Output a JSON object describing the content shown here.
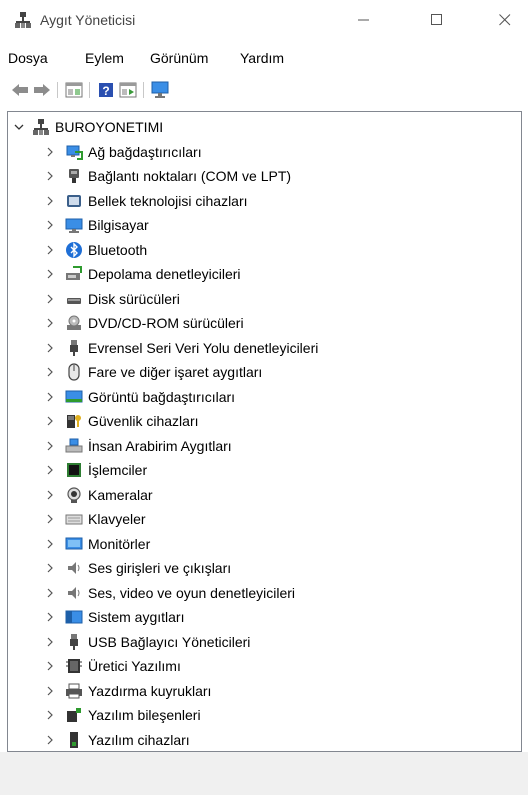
{
  "window": {
    "title": "Aygıt Yöneticisi"
  },
  "menu": [
    "Dosya",
    "Eylem",
    "Görünüm",
    "Yardım"
  ],
  "toolbar": {
    "buttons": [
      {
        "name": "back-icon"
      },
      {
        "name": "forward-icon"
      },
      {
        "name": "properties-icon"
      },
      {
        "name": "help-icon"
      },
      {
        "name": "update-driver-icon"
      },
      {
        "name": "scan-hardware-icon"
      }
    ]
  },
  "tree": {
    "root": {
      "label": "BUROYONETIMI",
      "expanded": true,
      "icon": "computer-icon"
    },
    "items": [
      {
        "label": "Ağ bağdaştırıcıları",
        "icon": "network-adapter-icon"
      },
      {
        "label": "Bağlantı noktaları (COM ve LPT)",
        "icon": "port-icon"
      },
      {
        "label": "Bellek teknolojisi cihazları",
        "icon": "memory-device-icon"
      },
      {
        "label": "Bilgisayar",
        "icon": "computer-monitor-icon"
      },
      {
        "label": "Bluetooth",
        "icon": "bluetooth-icon"
      },
      {
        "label": "Depolama denetleyicileri",
        "icon": "storage-controller-icon"
      },
      {
        "label": "Disk sürücüleri",
        "icon": "disk-drive-icon"
      },
      {
        "label": "DVD/CD-ROM sürücüleri",
        "icon": "dvd-drive-icon"
      },
      {
        "label": "Evrensel Seri Veri Yolu denetleyicileri",
        "icon": "usb-controller-icon"
      },
      {
        "label": "Fare ve diğer işaret aygıtları",
        "icon": "mouse-icon"
      },
      {
        "label": "Görüntü bağdaştırıcıları",
        "icon": "display-adapter-icon"
      },
      {
        "label": "Güvenlik cihazları",
        "icon": "security-device-icon"
      },
      {
        "label": "İnsan Arabirim Aygıtları",
        "icon": "hid-icon"
      },
      {
        "label": "İşlemciler",
        "icon": "processor-icon"
      },
      {
        "label": "Kameralar",
        "icon": "camera-icon"
      },
      {
        "label": "Klavyeler",
        "icon": "keyboard-icon"
      },
      {
        "label": "Monitörler",
        "icon": "monitor-icon"
      },
      {
        "label": "Ses girişleri ve çıkışları",
        "icon": "audio-io-icon"
      },
      {
        "label": "Ses, video ve oyun denetleyicileri",
        "icon": "sound-controller-icon"
      },
      {
        "label": "Sistem aygıtları",
        "icon": "system-device-icon"
      },
      {
        "label": "USB Bağlayıcı Yöneticileri",
        "icon": "usb-connector-icon"
      },
      {
        "label": "Üretici Yazılımı",
        "icon": "firmware-icon"
      },
      {
        "label": "Yazdırma kuyrukları",
        "icon": "print-queue-icon"
      },
      {
        "label": "Yazılım bileşenleri",
        "icon": "software-component-icon"
      },
      {
        "label": "Yazılım cihazları",
        "icon": "software-device-icon"
      }
    ]
  },
  "status": {
    "text": ""
  }
}
